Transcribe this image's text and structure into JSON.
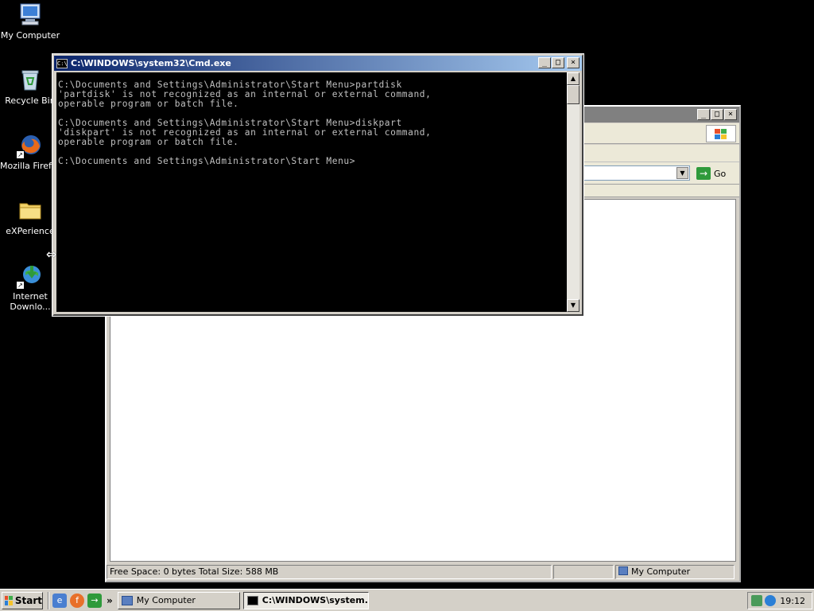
{
  "desktop": {
    "icons": [
      {
        "label": "My Computer"
      },
      {
        "label": "Recycle Bin"
      },
      {
        "label": "Mozilla Firefox"
      },
      {
        "label": "eXPerience"
      },
      {
        "label_line1": "Internet",
        "label_line2": "Downlo..."
      }
    ]
  },
  "cmd_window": {
    "title": "C:\\WINDOWS\\system32\\Cmd.exe",
    "console_lines": [
      "C:\\Documents and Settings\\Administrator\\Start Menu>partdisk",
      "'partdisk' is not recognized as an internal or external command,",
      "operable program or batch file.",
      "",
      "C:\\Documents and Settings\\Administrator\\Start Menu>diskpart",
      "'diskpart' is not recognized as an internal or external command,",
      "operable program or batch file.",
      "",
      "C:\\Documents and Settings\\Administrator\\Start Menu>"
    ]
  },
  "explorer_window": {
    "go_label": "Go",
    "status": {
      "space": "Free Space: 0 bytes Total Size: 588 MB",
      "location": "My Computer"
    }
  },
  "taskbar": {
    "start_label": "Start",
    "quicklaunch_more": "»",
    "tasks": [
      {
        "label": "My Computer",
        "active": false
      },
      {
        "label": "C:\\WINDOWS\\system...",
        "active": true
      }
    ],
    "clock": "19:12"
  }
}
